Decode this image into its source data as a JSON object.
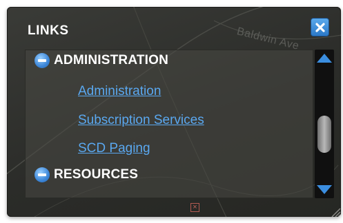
{
  "panel": {
    "title": "LINKS",
    "close_icon": "close-icon",
    "background_street": "Baldwin Ave",
    "accent_color": "#3b8ee0",
    "link_color": "#5aa8f0"
  },
  "sections": [
    {
      "label": "ADMINISTRATION",
      "icon": "collapse-minus-icon",
      "links": [
        "Administration",
        "Subscription Services",
        "SCD Paging"
      ]
    },
    {
      "label": "RESOURCES",
      "icon": "collapse-minus-icon",
      "links": []
    }
  ],
  "scrollbar": {
    "up_icon": "scroll-up-arrow-icon",
    "down_icon": "scroll-down-arrow-icon"
  }
}
